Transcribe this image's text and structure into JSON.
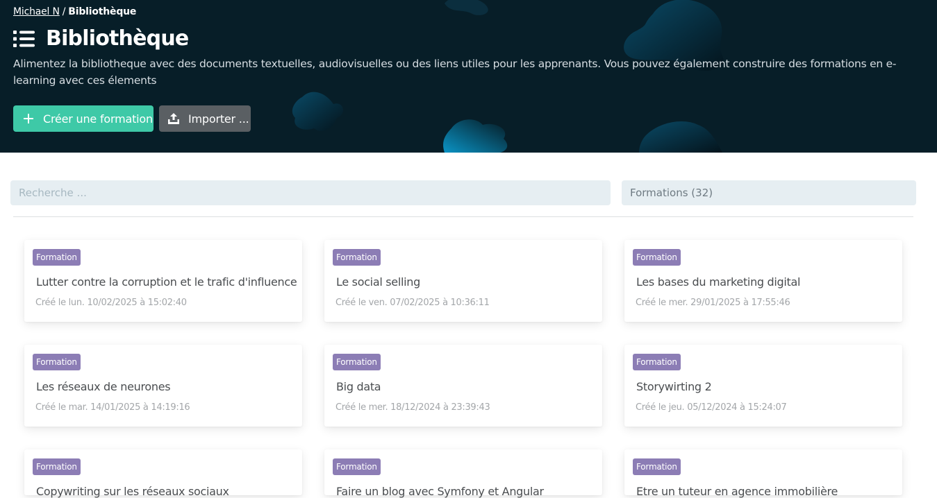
{
  "breadcrumb": {
    "parent": "Michael N",
    "separator": "/",
    "current": "Bibliothèque"
  },
  "header": {
    "title": "Bibliothèque",
    "icon": "list-icon",
    "description": "Alimentez la bibliotheque avec des documents textuelles, audiovisuelles ou des liens utiles pour les apprenants. Vous pouvez également construire des formations en e-learning avec ces élements"
  },
  "actions": {
    "create_label": "Créer une formation",
    "create_icon": "plus-icon",
    "import_label": "Importer ...",
    "import_icon": "upload-icon"
  },
  "search": {
    "placeholder": "Recherche ...",
    "value": ""
  },
  "filter": {
    "selected": "Formations (32)"
  },
  "colors": {
    "header_bg": "#071e28",
    "create_button": "#3ec9a7",
    "import_button": "#5a5f63",
    "badge": "#8c7db5",
    "input_bg": "#e6eef2"
  },
  "cards": [
    {
      "badge": "Formation",
      "title": "Lutter contre la corruption et le trafic d'influence",
      "date": "Créé le lun. 10/02/2025 à 15:02:40"
    },
    {
      "badge": "Formation",
      "title": "Le social selling",
      "date": "Créé le ven. 07/02/2025 à 10:36:11"
    },
    {
      "badge": "Formation",
      "title": "Les bases du marketing digital",
      "date": "Créé le mer. 29/01/2025 à 17:55:46"
    },
    {
      "badge": "Formation",
      "title": "Les réseaux de neurones",
      "date": "Créé le mar. 14/01/2025 à 14:19:16"
    },
    {
      "badge": "Formation",
      "title": "Big data",
      "date": "Créé le mer. 18/12/2024 à 23:39:43"
    },
    {
      "badge": "Formation",
      "title": "Storywirting 2",
      "date": "Créé le jeu. 05/12/2024 à 15:24:07"
    },
    {
      "badge": "Formation",
      "title": "Copywriting sur les réseaux sociaux",
      "date": ""
    },
    {
      "badge": "Formation",
      "title": "Faire un blog avec Symfony et Angular",
      "date": ""
    },
    {
      "badge": "Formation",
      "title": "Etre un tuteur en agence immobilière",
      "date": ""
    }
  ]
}
